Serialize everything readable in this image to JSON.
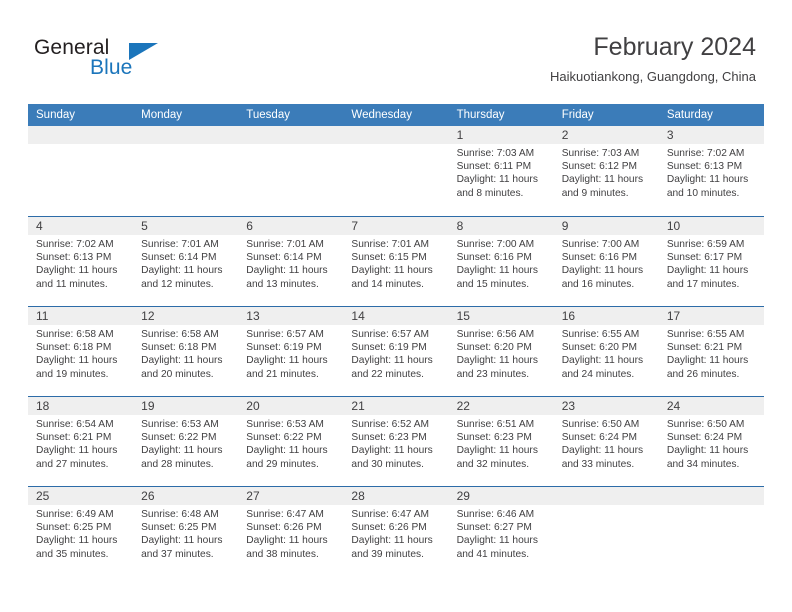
{
  "brand": {
    "name_top": "General",
    "name_bottom": "Blue",
    "triangle_icon": "triangle-icon",
    "color_top": "#231f20",
    "color_bottom": "#1b75bb"
  },
  "header": {
    "title": "February 2024",
    "subtitle": "Haikuotiankong, Guangdong, China"
  },
  "theme": {
    "header_blue": "#3b7cb9",
    "row_rule_blue": "#2d6ca8",
    "day_band_gray": "#efefef",
    "text": "#414042"
  },
  "weekdays": [
    "Sunday",
    "Monday",
    "Tuesday",
    "Wednesday",
    "Thursday",
    "Friday",
    "Saturday"
  ],
  "labels": {
    "sunrise": "Sunrise:",
    "sunset": "Sunset:",
    "daylight": "Daylight:"
  },
  "weeks": [
    [
      {
        "day": "",
        "sunrise": "",
        "sunset": "",
        "daylight1": "",
        "daylight2": ""
      },
      {
        "day": "",
        "sunrise": "",
        "sunset": "",
        "daylight1": "",
        "daylight2": ""
      },
      {
        "day": "",
        "sunrise": "",
        "sunset": "",
        "daylight1": "",
        "daylight2": ""
      },
      {
        "day": "",
        "sunrise": "",
        "sunset": "",
        "daylight1": "",
        "daylight2": ""
      },
      {
        "day": "1",
        "sunrise": "Sunrise: 7:03 AM",
        "sunset": "Sunset: 6:11 PM",
        "daylight1": "Daylight: 11 hours",
        "daylight2": "and 8 minutes."
      },
      {
        "day": "2",
        "sunrise": "Sunrise: 7:03 AM",
        "sunset": "Sunset: 6:12 PM",
        "daylight1": "Daylight: 11 hours",
        "daylight2": "and 9 minutes."
      },
      {
        "day": "3",
        "sunrise": "Sunrise: 7:02 AM",
        "sunset": "Sunset: 6:13 PM",
        "daylight1": "Daylight: 11 hours",
        "daylight2": "and 10 minutes."
      }
    ],
    [
      {
        "day": "4",
        "sunrise": "Sunrise: 7:02 AM",
        "sunset": "Sunset: 6:13 PM",
        "daylight1": "Daylight: 11 hours",
        "daylight2": "and 11 minutes."
      },
      {
        "day": "5",
        "sunrise": "Sunrise: 7:01 AM",
        "sunset": "Sunset: 6:14 PM",
        "daylight1": "Daylight: 11 hours",
        "daylight2": "and 12 minutes."
      },
      {
        "day": "6",
        "sunrise": "Sunrise: 7:01 AM",
        "sunset": "Sunset: 6:14 PM",
        "daylight1": "Daylight: 11 hours",
        "daylight2": "and 13 minutes."
      },
      {
        "day": "7",
        "sunrise": "Sunrise: 7:01 AM",
        "sunset": "Sunset: 6:15 PM",
        "daylight1": "Daylight: 11 hours",
        "daylight2": "and 14 minutes."
      },
      {
        "day": "8",
        "sunrise": "Sunrise: 7:00 AM",
        "sunset": "Sunset: 6:16 PM",
        "daylight1": "Daylight: 11 hours",
        "daylight2": "and 15 minutes."
      },
      {
        "day": "9",
        "sunrise": "Sunrise: 7:00 AM",
        "sunset": "Sunset: 6:16 PM",
        "daylight1": "Daylight: 11 hours",
        "daylight2": "and 16 minutes."
      },
      {
        "day": "10",
        "sunrise": "Sunrise: 6:59 AM",
        "sunset": "Sunset: 6:17 PM",
        "daylight1": "Daylight: 11 hours",
        "daylight2": "and 17 minutes."
      }
    ],
    [
      {
        "day": "11",
        "sunrise": "Sunrise: 6:58 AM",
        "sunset": "Sunset: 6:18 PM",
        "daylight1": "Daylight: 11 hours",
        "daylight2": "and 19 minutes."
      },
      {
        "day": "12",
        "sunrise": "Sunrise: 6:58 AM",
        "sunset": "Sunset: 6:18 PM",
        "daylight1": "Daylight: 11 hours",
        "daylight2": "and 20 minutes."
      },
      {
        "day": "13",
        "sunrise": "Sunrise: 6:57 AM",
        "sunset": "Sunset: 6:19 PM",
        "daylight1": "Daylight: 11 hours",
        "daylight2": "and 21 minutes."
      },
      {
        "day": "14",
        "sunrise": "Sunrise: 6:57 AM",
        "sunset": "Sunset: 6:19 PM",
        "daylight1": "Daylight: 11 hours",
        "daylight2": "and 22 minutes."
      },
      {
        "day": "15",
        "sunrise": "Sunrise: 6:56 AM",
        "sunset": "Sunset: 6:20 PM",
        "daylight1": "Daylight: 11 hours",
        "daylight2": "and 23 minutes."
      },
      {
        "day": "16",
        "sunrise": "Sunrise: 6:55 AM",
        "sunset": "Sunset: 6:20 PM",
        "daylight1": "Daylight: 11 hours",
        "daylight2": "and 24 minutes."
      },
      {
        "day": "17",
        "sunrise": "Sunrise: 6:55 AM",
        "sunset": "Sunset: 6:21 PM",
        "daylight1": "Daylight: 11 hours",
        "daylight2": "and 26 minutes."
      }
    ],
    [
      {
        "day": "18",
        "sunrise": "Sunrise: 6:54 AM",
        "sunset": "Sunset: 6:21 PM",
        "daylight1": "Daylight: 11 hours",
        "daylight2": "and 27 minutes."
      },
      {
        "day": "19",
        "sunrise": "Sunrise: 6:53 AM",
        "sunset": "Sunset: 6:22 PM",
        "daylight1": "Daylight: 11 hours",
        "daylight2": "and 28 minutes."
      },
      {
        "day": "20",
        "sunrise": "Sunrise: 6:53 AM",
        "sunset": "Sunset: 6:22 PM",
        "daylight1": "Daylight: 11 hours",
        "daylight2": "and 29 minutes."
      },
      {
        "day": "21",
        "sunrise": "Sunrise: 6:52 AM",
        "sunset": "Sunset: 6:23 PM",
        "daylight1": "Daylight: 11 hours",
        "daylight2": "and 30 minutes."
      },
      {
        "day": "22",
        "sunrise": "Sunrise: 6:51 AM",
        "sunset": "Sunset: 6:23 PM",
        "daylight1": "Daylight: 11 hours",
        "daylight2": "and 32 minutes."
      },
      {
        "day": "23",
        "sunrise": "Sunrise: 6:50 AM",
        "sunset": "Sunset: 6:24 PM",
        "daylight1": "Daylight: 11 hours",
        "daylight2": "and 33 minutes."
      },
      {
        "day": "24",
        "sunrise": "Sunrise: 6:50 AM",
        "sunset": "Sunset: 6:24 PM",
        "daylight1": "Daylight: 11 hours",
        "daylight2": "and 34 minutes."
      }
    ],
    [
      {
        "day": "25",
        "sunrise": "Sunrise: 6:49 AM",
        "sunset": "Sunset: 6:25 PM",
        "daylight1": "Daylight: 11 hours",
        "daylight2": "and 35 minutes."
      },
      {
        "day": "26",
        "sunrise": "Sunrise: 6:48 AM",
        "sunset": "Sunset: 6:25 PM",
        "daylight1": "Daylight: 11 hours",
        "daylight2": "and 37 minutes."
      },
      {
        "day": "27",
        "sunrise": "Sunrise: 6:47 AM",
        "sunset": "Sunset: 6:26 PM",
        "daylight1": "Daylight: 11 hours",
        "daylight2": "and 38 minutes."
      },
      {
        "day": "28",
        "sunrise": "Sunrise: 6:47 AM",
        "sunset": "Sunset: 6:26 PM",
        "daylight1": "Daylight: 11 hours",
        "daylight2": "and 39 minutes."
      },
      {
        "day": "29",
        "sunrise": "Sunrise: 6:46 AM",
        "sunset": "Sunset: 6:27 PM",
        "daylight1": "Daylight: 11 hours",
        "daylight2": "and 41 minutes."
      },
      {
        "day": "",
        "sunrise": "",
        "sunset": "",
        "daylight1": "",
        "daylight2": ""
      },
      {
        "day": "",
        "sunrise": "",
        "sunset": "",
        "daylight1": "",
        "daylight2": ""
      }
    ]
  ]
}
